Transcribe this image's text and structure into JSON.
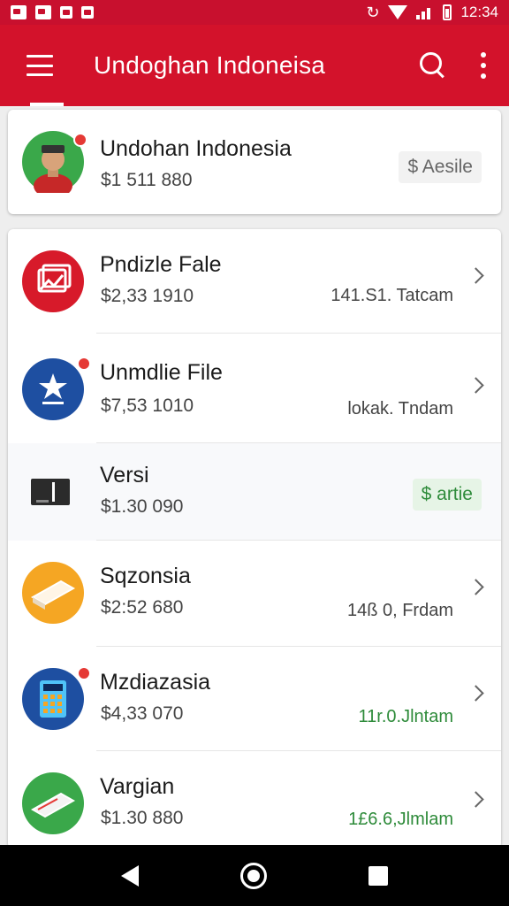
{
  "status_bar": {
    "time": "12:34",
    "left_icons": [
      "notification-icon",
      "whatsapp-icon",
      "app-icon",
      "clipboard-icon"
    ],
    "right_icons": [
      "sync-icon",
      "wifi-icon",
      "signal-icon",
      "battery-icon"
    ]
  },
  "app_bar": {
    "title": "Undoghan Indoneisa",
    "actions": [
      "search-icon",
      "more-vert-icon"
    ]
  },
  "colors": {
    "primary": "#d3122b",
    "accent_green": "#2e8b3a",
    "badge_red": "#e53935"
  },
  "account": {
    "name": "Undohan Indonesia",
    "amount": "$1 511 880",
    "pill": "$ Aesile"
  },
  "items": [
    {
      "name": "Pndizle Fale",
      "amount": "$2,33 1910",
      "meta": "141.S1. Tatcam",
      "meta_color": "dark",
      "icon": "image-icon",
      "icon_bg": "#d71a2a",
      "badge": false
    },
    {
      "name": "Unmdlie File",
      "amount": "$7,53 1010",
      "meta": "lokak. Tndam",
      "meta_color": "dark",
      "icon": "star-icon",
      "icon_bg": "#1e4fa1",
      "badge": true
    },
    {
      "name": "Versi",
      "amount": "$1.30 090",
      "pill": "$ artie",
      "icon": "card-reader-icon",
      "icon_bg": "transparent",
      "badge": false
    },
    {
      "name": "Sqzonsia",
      "amount": "$2:52 680",
      "meta": "14ß 0, Frdam",
      "meta_color": "dark",
      "icon": "ticket-icon",
      "icon_bg": "#f5a623",
      "badge": false
    },
    {
      "name": "Mzdiazasia",
      "amount": "$4,33 070",
      "meta": "11r.0.Jlntam",
      "meta_color": "green",
      "icon": "calculator-icon",
      "icon_bg": "#1e4fa1",
      "badge": true
    },
    {
      "name": "Vargian",
      "amount": "$1.30 880",
      "meta": "1£6.6,Jlmlam",
      "meta_color": "green",
      "icon": "ticket-icon",
      "icon_bg": "#3aa84a",
      "badge": false
    }
  ],
  "nav": [
    "back-icon",
    "home-icon",
    "recents-icon"
  ]
}
